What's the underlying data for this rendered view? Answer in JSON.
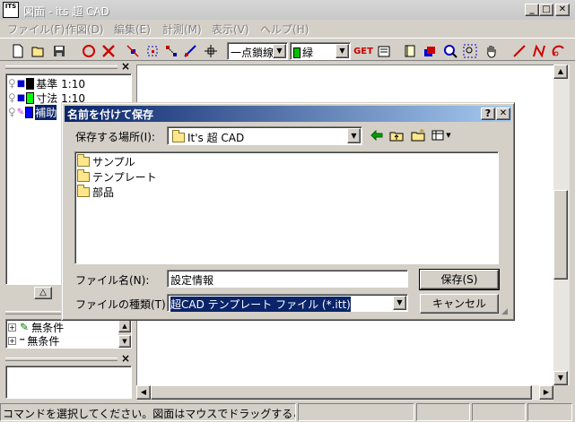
{
  "window": {
    "title": "図面 - its 超 CAD",
    "icon_text": "ITS",
    "caption_buttons": {
      "minimize": "_",
      "maximize": "□",
      "close": "✕"
    }
  },
  "menu": {
    "items": [
      "ファイル(F)",
      "作図(D)",
      "編集(E)",
      "計測(M)",
      "表示(V)",
      "ヘルプ(H)"
    ]
  },
  "toolbar": {
    "linetype_value": "一点鎖線",
    "color_value": "緑",
    "get_label": "GET",
    "colors": {
      "accent_red": "#cc0000",
      "green": "#00c000"
    }
  },
  "layers": {
    "rows": [
      {
        "label": "基準 1:10",
        "color": "#000000"
      },
      {
        "label": "寸法 1:10",
        "color": "#00ff00"
      },
      {
        "label": "補助",
        "color": "#0000ff"
      }
    ],
    "up_label": "△"
  },
  "conditions": {
    "rows": [
      {
        "label": "無条件",
        "expand": "+"
      },
      {
        "label": "無条件",
        "expand": "+"
      }
    ]
  },
  "status": {
    "text": "コマンドを選択してください。図面はマウスでドラッグすることもできます。("
  },
  "dialog": {
    "title": "名前を付けて保存",
    "help_btn": "?",
    "close_btn": "✕",
    "location_label": "保存する場所(I):",
    "location_value": "It's 超 CAD",
    "files": [
      "サンプル",
      "テンプレート",
      "部品"
    ],
    "filename_label": "ファイル名(N):",
    "filename_value": "設定情報",
    "filetype_label": "ファイルの種類(T):",
    "filetype_value": "超CAD テンプレート ファイル (*.itt)",
    "save_button": "保存(S)",
    "cancel_button": "キャンセル"
  }
}
